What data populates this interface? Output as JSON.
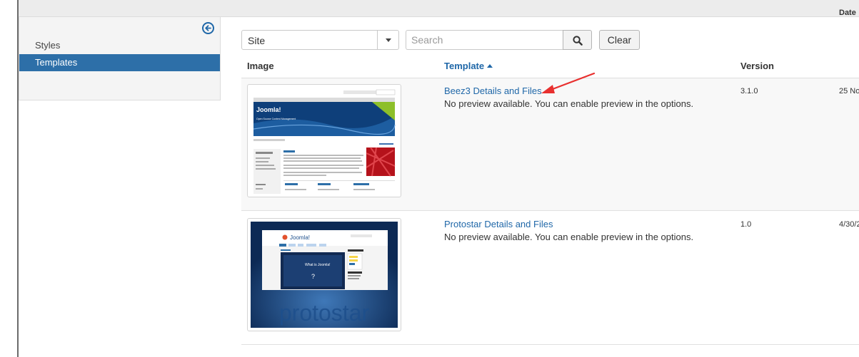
{
  "sidebar": {
    "items": [
      {
        "label": "Styles",
        "active": false
      },
      {
        "label": "Templates",
        "active": true
      }
    ]
  },
  "filters": {
    "client_select": "Site",
    "search_placeholder": "Search",
    "clear_label": "Clear"
  },
  "table": {
    "headers": {
      "image": "Image",
      "template": "Template",
      "version": "Version",
      "date": "Date"
    },
    "sort": {
      "column": "template",
      "direction": "ascending"
    },
    "rows": [
      {
        "link": "Beez3 Details and Files",
        "note": "No preview available. You can enable preview in the options.",
        "version": "3.1.0",
        "date": "25 No"
      },
      {
        "link": "Protostar Details and Files",
        "note": "No preview available. You can enable preview in the options.",
        "version": "1.0",
        "date": "4/30/2"
      }
    ]
  },
  "thumbnails": {
    "beez3": {
      "brand": "Joomla!",
      "tagline": "Open Source Content Management"
    },
    "protostar": {
      "wordmark": "protostar",
      "logo": "Joomla!",
      "video_title": "What is Joomla!"
    }
  },
  "colors": {
    "accent": "#1f67a8",
    "active_item": "#2d6fa8",
    "annotation_arrow": "#e8302f"
  }
}
